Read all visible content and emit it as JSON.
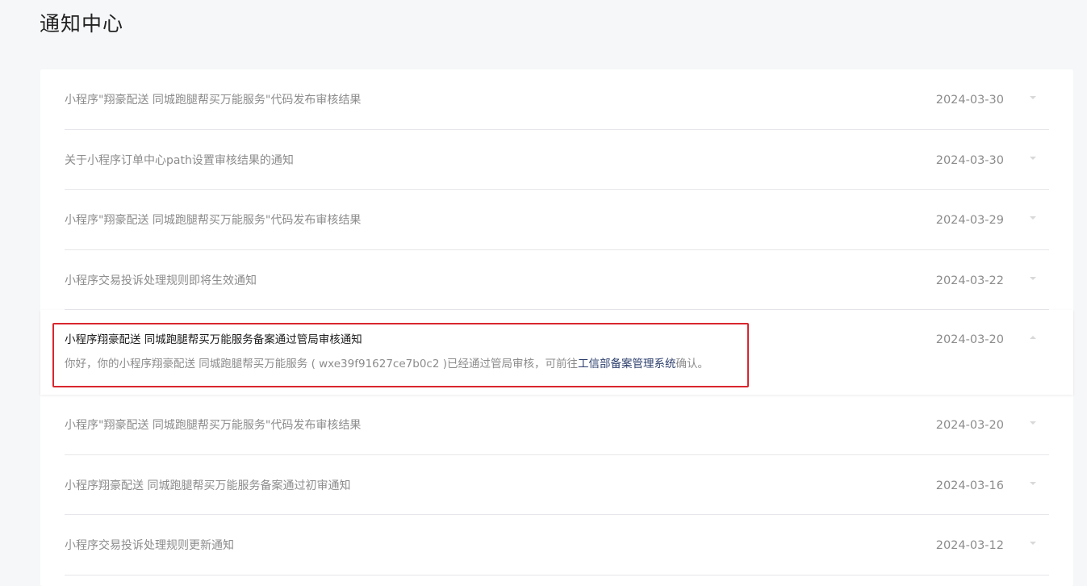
{
  "page": {
    "title": "通知中心"
  },
  "notices": [
    {
      "title": "小程序\"翔豪配送 同城跑腿帮买万能服务\"代码发布审核结果",
      "date": "2024-03-30"
    },
    {
      "title": "关于小程序订单中心path设置审核结果的通知",
      "date": "2024-03-30"
    },
    {
      "title": "小程序\"翔豪配送 同城跑腿帮买万能服务\"代码发布审核结果",
      "date": "2024-03-29"
    },
    {
      "title": "小程序交易投诉处理规则即将生效通知",
      "date": "2024-03-22"
    },
    {
      "title": "小程序翔豪配送 同城跑腿帮买万能服务备案通过管局审核通知",
      "date": "2024-03-20",
      "expanded": true,
      "body_prefix": "你好，你的小程序翔豪配送 同城跑腿帮买万能服务 ( wxe39f91627ce7b0c2 )已经通过管局审核，可前往",
      "body_link": "工信部备案管理系统",
      "body_suffix": "确认。"
    },
    {
      "title": "小程序\"翔豪配送 同城跑腿帮买万能服务\"代码发布审核结果",
      "date": "2024-03-20"
    },
    {
      "title": "小程序翔豪配送 同城跑腿帮买万能服务备案通过初审通知",
      "date": "2024-03-16"
    },
    {
      "title": "小程序交易投诉处理规则更新通知",
      "date": "2024-03-12"
    }
  ],
  "colors": {
    "highlight_border": "#d9262e",
    "link": "#2a3d6b"
  }
}
